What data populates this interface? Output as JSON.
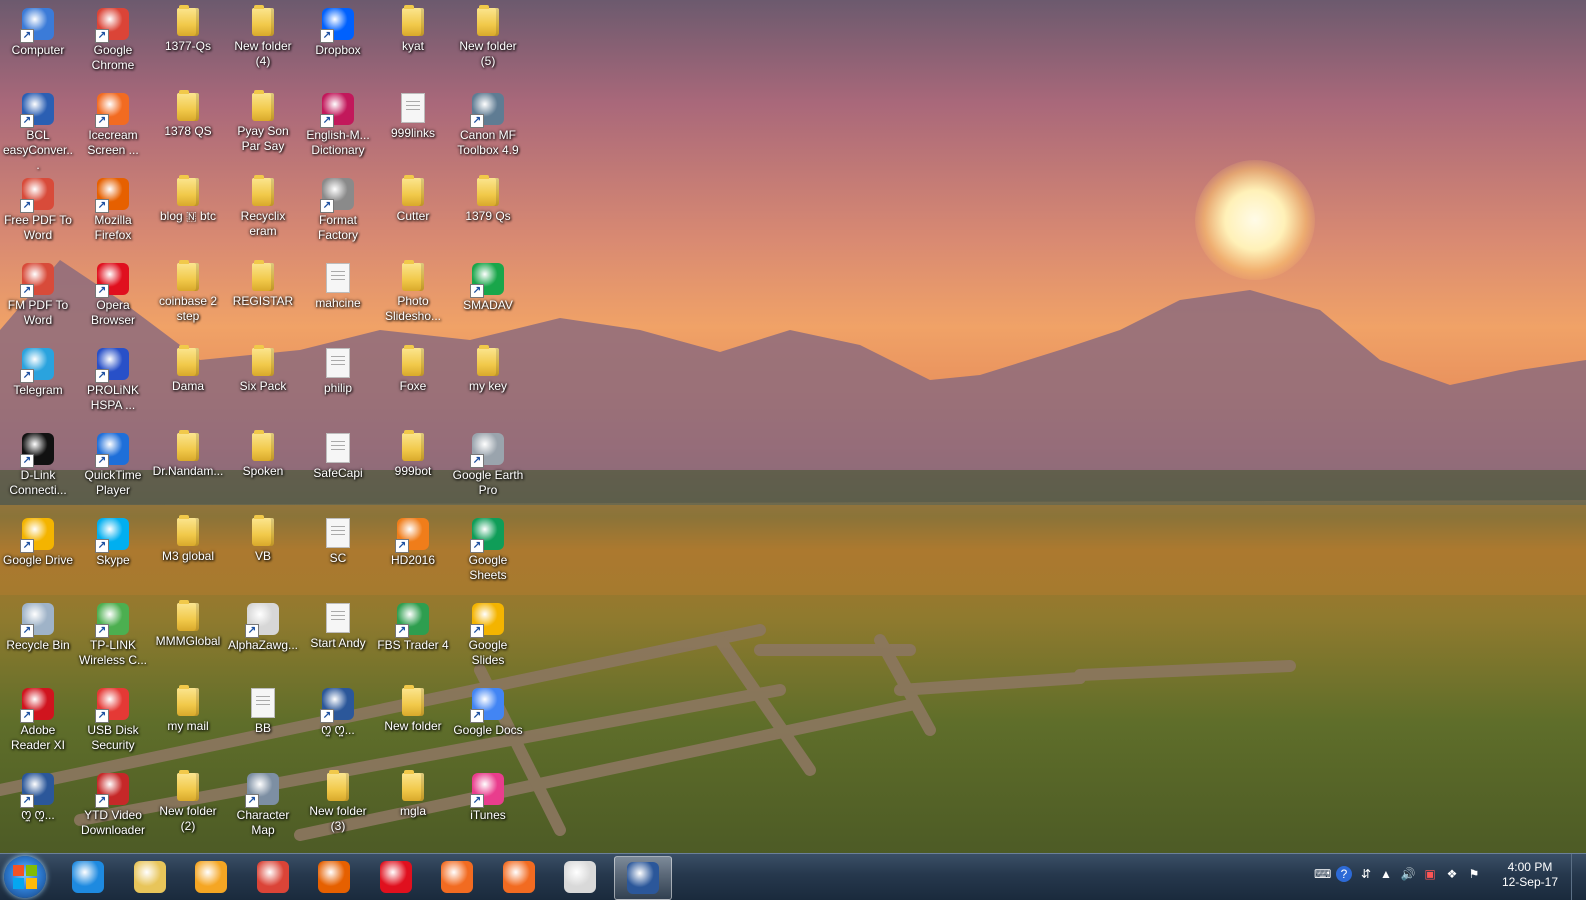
{
  "desktop_icons": [
    {
      "label": "Computer",
      "kind": "app",
      "color": "#3b7bd8"
    },
    {
      "label": "Google Chrome",
      "kind": "app",
      "color": "#db4437"
    },
    {
      "label": "1377-Qs",
      "kind": "folder"
    },
    {
      "label": "New folder (4)",
      "kind": "folder"
    },
    {
      "label": "Dropbox",
      "kind": "app",
      "color": "#0061fe"
    },
    {
      "label": "kyat",
      "kind": "folder"
    },
    {
      "label": "New folder (5)",
      "kind": "folder"
    },
    {
      "label": "BCL easyConver...",
      "kind": "app",
      "color": "#2b5fb3"
    },
    {
      "label": "Icecream Screen ...",
      "kind": "app",
      "color": "#f26b21"
    },
    {
      "label": "1378 QS",
      "kind": "folder"
    },
    {
      "label": "Pyay Son Par Say",
      "kind": "folder"
    },
    {
      "label": "English-M... Dictionary",
      "kind": "app",
      "color": "#c2185b"
    },
    {
      "label": "999links",
      "kind": "doc"
    },
    {
      "label": "Canon MF Toolbox 4.9",
      "kind": "app",
      "color": "#5f7c93"
    },
    {
      "label": "Free PDF To Word",
      "kind": "app",
      "color": "#d84b3a"
    },
    {
      "label": "Mozilla Firefox",
      "kind": "app",
      "color": "#e66000"
    },
    {
      "label": "blog 🇳 btc",
      "kind": "folder"
    },
    {
      "label": "Recyclix eram",
      "kind": "folder"
    },
    {
      "label": "Format Factory",
      "kind": "app",
      "color": "#8a8a8a"
    },
    {
      "label": "Cutter",
      "kind": "folder"
    },
    {
      "label": "1379 Qs",
      "kind": "folder"
    },
    {
      "label": "FM PDF To Word",
      "kind": "app",
      "color": "#d84b3a"
    },
    {
      "label": "Opera Browser",
      "kind": "app",
      "color": "#e0101e"
    },
    {
      "label": "coinbase 2 step",
      "kind": "folder"
    },
    {
      "label": "REGISTAR",
      "kind": "folder"
    },
    {
      "label": "mahcine",
      "kind": "doc"
    },
    {
      "label": "Photo Slidesho...",
      "kind": "folder"
    },
    {
      "label": "SMADAV",
      "kind": "app",
      "color": "#19a64a"
    },
    {
      "label": "Telegram",
      "kind": "app",
      "color": "#2aa3de"
    },
    {
      "label": "PROLiNK HSPA ...",
      "kind": "app",
      "color": "#2850c8"
    },
    {
      "label": "Dama",
      "kind": "folder"
    },
    {
      "label": "Six Pack",
      "kind": "folder"
    },
    {
      "label": "philip",
      "kind": "doc"
    },
    {
      "label": "Foxe",
      "kind": "folder"
    },
    {
      "label": "my key",
      "kind": "folder"
    },
    {
      "label": "D-Link Connecti...",
      "kind": "app",
      "color": "#111111"
    },
    {
      "label": "QuickTime Player",
      "kind": "app",
      "color": "#1e6fd9"
    },
    {
      "label": "Dr.Nandam...",
      "kind": "folder"
    },
    {
      "label": "Spoken",
      "kind": "folder"
    },
    {
      "label": "SafeCapi",
      "kind": "doc"
    },
    {
      "label": "999bot",
      "kind": "folder"
    },
    {
      "label": "Google Earth Pro",
      "kind": "app",
      "color": "#9aa4ad"
    },
    {
      "label": "Google Drive",
      "kind": "app",
      "color": "#f4b400"
    },
    {
      "label": "Skype",
      "kind": "app",
      "color": "#00aff0"
    },
    {
      "label": "M3 global",
      "kind": "folder"
    },
    {
      "label": "VB",
      "kind": "folder"
    },
    {
      "label": "SC",
      "kind": "doc"
    },
    {
      "label": "HD2016",
      "kind": "app",
      "color": "#f07d1a"
    },
    {
      "label": "Google Sheets",
      "kind": "app",
      "color": "#0f9d58"
    },
    {
      "label": "Recycle Bin",
      "kind": "app",
      "color": "#9fb3c8"
    },
    {
      "label": "TP-LINK Wireless C...",
      "kind": "app",
      "color": "#4caf50"
    },
    {
      "label": "MMMGlobal",
      "kind": "folder"
    },
    {
      "label": "AlphaZawg...",
      "kind": "app",
      "color": "#d7d7d7"
    },
    {
      "label": "Start Andy",
      "kind": "doc"
    },
    {
      "label": "FBS Trader 4",
      "kind": "app",
      "color": "#2e9e4f"
    },
    {
      "label": "Google Slides",
      "kind": "app",
      "color": "#f4b400"
    },
    {
      "label": "Adobe Reader XI",
      "kind": "app",
      "color": "#d0141e"
    },
    {
      "label": "USB Disk Security",
      "kind": "app",
      "color": "#e53935"
    },
    {
      "label": "my mail",
      "kind": "folder"
    },
    {
      "label": "BB",
      "kind": "doc"
    },
    {
      "label": "ꯁꯨ ꯁꯨ...",
      "kind": "app",
      "color": "#2b579a"
    },
    {
      "label": "New folder",
      "kind": "folder"
    },
    {
      "label": "Google Docs",
      "kind": "app",
      "color": "#4285f4"
    },
    {
      "label": "ꯁꯨ ꯁꯨ...",
      "kind": "app",
      "color": "#2b579a"
    },
    {
      "label": "YTD Video Downloader",
      "kind": "app",
      "color": "#c62828"
    },
    {
      "label": "New folder (2)",
      "kind": "folder"
    },
    {
      "label": "Character Map",
      "kind": "app",
      "color": "#7d8fa3"
    },
    {
      "label": "New folder (3)",
      "kind": "folder"
    },
    {
      "label": "mgla",
      "kind": "folder"
    },
    {
      "label": "iTunes",
      "kind": "app",
      "color": "#e93d8d"
    }
  ],
  "taskbar": {
    "buttons": [
      {
        "name": "internet-explorer-icon",
        "color": "#1e8ae0"
      },
      {
        "name": "file-explorer-icon",
        "color": "#e8c55a"
      },
      {
        "name": "media-player-icon",
        "color": "#f5a623"
      },
      {
        "name": "chrome-icon",
        "color": "#db4437"
      },
      {
        "name": "firefox-icon",
        "color": "#e66000"
      },
      {
        "name": "opera-icon",
        "color": "#e0101e"
      },
      {
        "name": "icecream-recorder-icon",
        "color": "#f26b21"
      },
      {
        "name": "icecream-screenshot-icon",
        "color": "#f26b21"
      },
      {
        "name": "paint-icon",
        "color": "#d9d9d9"
      },
      {
        "name": "word-icon",
        "color": "#2b579a"
      }
    ],
    "clock_time": "4:00 PM",
    "clock_date": "12-Sep-17"
  }
}
